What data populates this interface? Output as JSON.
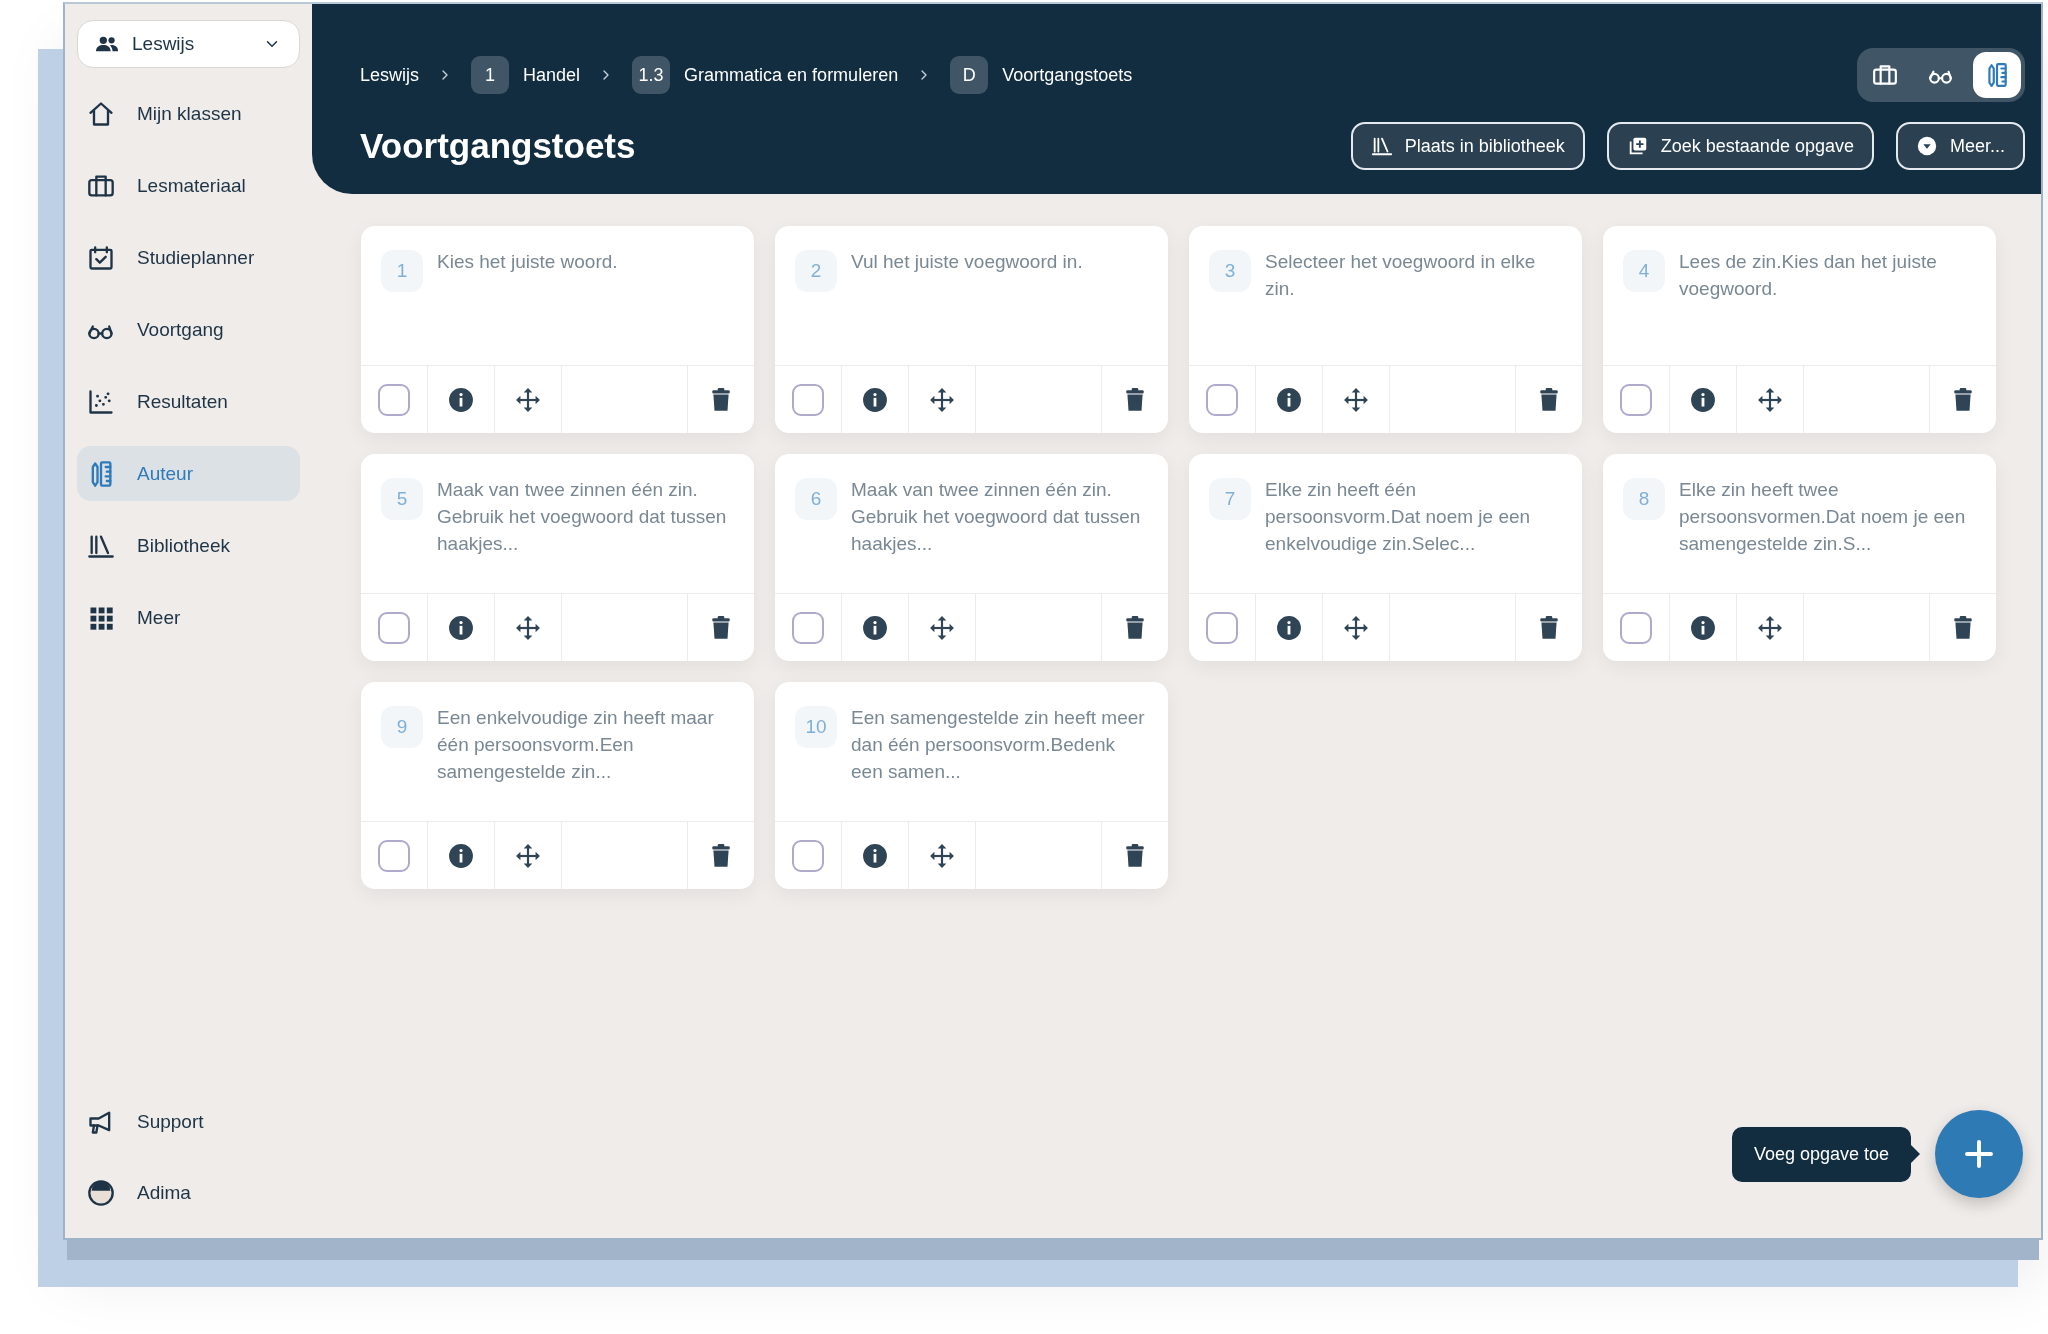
{
  "sidebar": {
    "org_selector": {
      "label": "Leswijs"
    },
    "items": [
      {
        "label": "Mijn klassen",
        "selected": false
      },
      {
        "label": "Lesmateriaal",
        "selected": false
      },
      {
        "label": "Studieplanner",
        "selected": false
      },
      {
        "label": "Voortgang",
        "selected": false
      },
      {
        "label": "Resultaten",
        "selected": false
      },
      {
        "label": "Auteur",
        "selected": true
      },
      {
        "label": "Bibliotheek",
        "selected": false
      },
      {
        "label": "Meer",
        "selected": false
      }
    ],
    "footer_items": [
      {
        "label": "Support"
      },
      {
        "label": "Adima"
      }
    ]
  },
  "header": {
    "breadcrumb": [
      {
        "label": "Leswijs"
      },
      {
        "badge": "1",
        "label": "Handel"
      },
      {
        "badge": "1.3",
        "label": "Grammatica en formuleren"
      },
      {
        "badge": "D",
        "label": "Voortgangstoets"
      }
    ],
    "title": "Voortgangstoets",
    "view_toggles": [
      {
        "selected": false
      },
      {
        "selected": false
      },
      {
        "selected": true
      }
    ],
    "buttons": [
      {
        "label": "Plaats in bibliotheek"
      },
      {
        "label": "Zoek bestaande opgave"
      },
      {
        "label": "Meer..."
      }
    ]
  },
  "questions": [
    {
      "number": "1",
      "text": "Kies het juiste woord.",
      "checked": false
    },
    {
      "number": "2",
      "text": "Vul het juiste voegwoord in.",
      "checked": false
    },
    {
      "number": "3",
      "text": "Selecteer het voegwoord in elke zin.",
      "checked": false
    },
    {
      "number": "4",
      "text": "Lees de zin.Kies dan het juiste voegwoord.",
      "checked": false
    },
    {
      "number": "5",
      "text": "Maak van twee zinnen één zin. Gebruik het voegwoord dat tussen haakjes...",
      "checked": false
    },
    {
      "number": "6",
      "text": "Maak van twee zinnen één zin. Gebruik het voegwoord dat tussen haakjes...",
      "checked": false
    },
    {
      "number": "7",
      "text": "Elke zin heeft één persoonsvorm.Dat noem je een enkelvoudige zin.Selec...",
      "checked": false
    },
    {
      "number": "8",
      "text": "Elke zin heeft twee persoonsvormen.Dat noem je een samengestelde zin.S...",
      "checked": false
    },
    {
      "number": "9",
      "text": "Een enkelvoudige zin heeft maar één persoonsvorm.Een samengestelde zin...",
      "checked": false
    },
    {
      "number": "10",
      "text": "Een samengestelde zin heeft meer dan één persoonsvorm.Bedenk een samen...",
      "checked": false
    }
  ],
  "add_button": {
    "tooltip": "Voeg opgave toe"
  }
}
